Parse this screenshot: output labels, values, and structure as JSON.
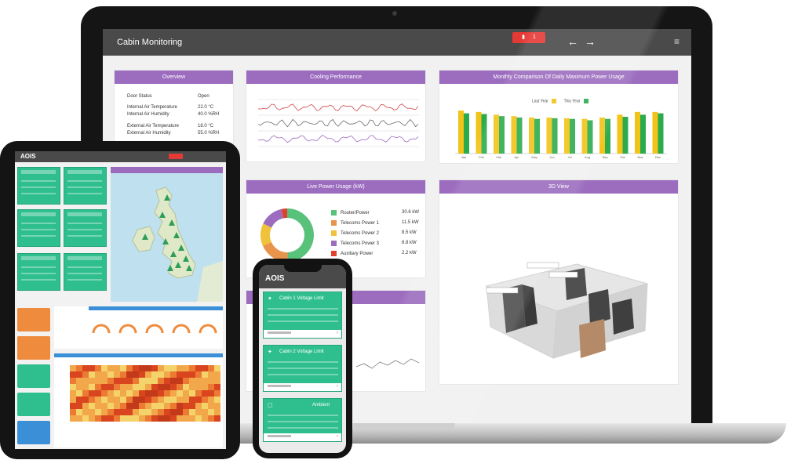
{
  "laptop": {
    "app_title": "Cabin Monitoring",
    "alert_label": "1",
    "icons": {
      "alert": "trash-icon",
      "back": "arrow-left-icon",
      "forward": "arrow-right-icon",
      "menu": "hamburger-icon"
    },
    "overview": {
      "title": "Overview",
      "rows": [
        {
          "label": "Door Status",
          "value": "Open"
        },
        {
          "label": "Internal Air Temperature",
          "value": "22.0 °C"
        },
        {
          "label": "Internal Air Humidity",
          "value": "40.0 %RH"
        },
        {
          "label": "External Air Temperature",
          "value": "18.0 °C"
        },
        {
          "label": "External Air Humidity",
          "value": "55.0 %RH"
        }
      ]
    },
    "cooling": {
      "title": "Cooling Performance"
    },
    "weekly": {
      "title": "Monthly Comparison Of Daily Maximum Power Usage",
      "legend": [
        "Last Year",
        "This Year"
      ],
      "colors": [
        "#f2c318",
        "#2bab4c"
      ]
    },
    "load": {
      "title": "Live Power Usage (kW)",
      "items": [
        {
          "label": "Router/Power",
          "value": "30.6 kW",
          "color": "#59c27a"
        },
        {
          "label": "Telecoms Power 1",
          "value": "11.5 kW",
          "color": "#e9944c"
        },
        {
          "label": "Telecoms Power 2",
          "value": "8.5 kW",
          "color": "#efc23a"
        },
        {
          "label": "Telecoms Power 3",
          "value": "8.8 kW",
          "color": "#9c6cbf"
        },
        {
          "label": "Auxiliary Power",
          "value": "2.2 kW",
          "color": "#e2402e"
        }
      ]
    },
    "view3d": {
      "title": "3D View"
    }
  },
  "chart_data": [
    {
      "type": "bar",
      "categories": [
        "Jan",
        "Feb",
        "Mar",
        "Apr",
        "May",
        "Jun",
        "Jul",
        "Aug",
        "Sep",
        "Oct",
        "Nov",
        "Dec"
      ],
      "series": [
        {
          "name": "Last Year",
          "values": [
            62,
            60,
            56,
            54,
            52,
            52,
            51,
            50,
            52,
            56,
            60,
            60
          ]
        },
        {
          "name": "This Year",
          "values": [
            58,
            57,
            54,
            52,
            50,
            51,
            50,
            48,
            50,
            53,
            56,
            58
          ]
        }
      ],
      "ylim": [
        0,
        70
      ]
    },
    {
      "type": "pie",
      "categories": [
        "Router/Power",
        "Telecoms Power 1",
        "Telecoms Power 2",
        "Telecoms Power 3",
        "Auxiliary Power"
      ],
      "values": [
        30.6,
        11.5,
        8.5,
        8.8,
        2.2
      ]
    }
  ],
  "tablet": {
    "logo": "AOIS"
  },
  "phone": {
    "logo": "AOIS",
    "cards": [
      {
        "title": "Cabin 1 Voltage Limit",
        "icon": "bulb-icon"
      },
      {
        "title": "Cabin 2 Voltage Limit",
        "icon": "bulb-icon"
      },
      {
        "title": "Ambient",
        "icon": "square-icon"
      }
    ]
  }
}
